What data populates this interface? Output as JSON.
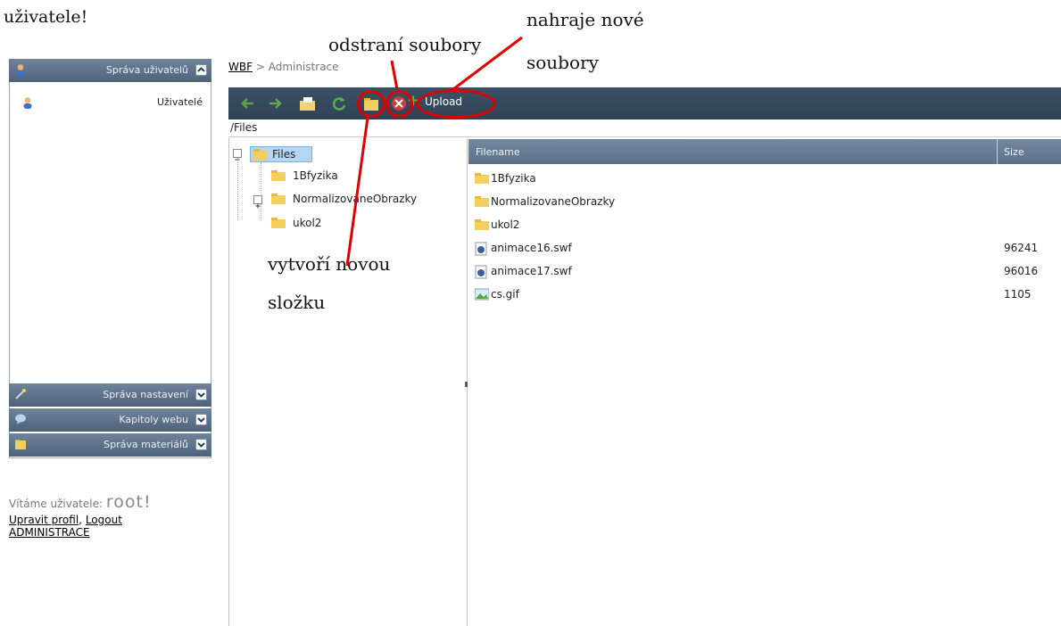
{
  "top_fragment": "uživatele!",
  "annotations": {
    "delete_files": "odstraní soubory",
    "upload_new_line1": "nahraje nové",
    "upload_new_line2": "soubory",
    "new_folder_line1": "vytvoří novou",
    "new_folder_line2": "složku"
  },
  "sidebar": {
    "sections": [
      {
        "label": "Správa uživatelů",
        "icon": "user-icon",
        "expanded": true
      },
      {
        "label": "Správa nastavení",
        "icon": "wand-icon",
        "expanded": false
      },
      {
        "label": "Kapitoly webu",
        "icon": "speech-bubble-icon",
        "expanded": false
      },
      {
        "label": "Správa materiálů",
        "icon": "folder-icon",
        "expanded": false
      }
    ],
    "items": [
      {
        "label": "Uživatelé",
        "icon": "user-icon"
      }
    ],
    "welcome_text": "Vítáme uživatele:",
    "username": "root!",
    "edit_profile": "Upravit profil",
    "logout": "Logout",
    "admin_link": "ADMINISTRACE"
  },
  "breadcrumb": {
    "link": "WBF",
    "separator": ">",
    "current": "Administrace"
  },
  "toolbar": {
    "upload_label": "Upload"
  },
  "path": "/Files",
  "tree": {
    "root": "Files",
    "children": [
      "1Bfyzika",
      "NormalizovaneObrazky",
      "ukol2"
    ]
  },
  "grid": {
    "columns": {
      "name": "Filename",
      "size": "Size"
    },
    "rows": [
      {
        "name": "1Bfyzika",
        "size": "",
        "type": "folder"
      },
      {
        "name": "NormalizovaneObrazky",
        "size": "",
        "type": "folder"
      },
      {
        "name": "ukol2",
        "size": "",
        "type": "folder"
      },
      {
        "name": "animace16.swf",
        "size": "96241",
        "type": "flash"
      },
      {
        "name": "animace17.swf",
        "size": "96016",
        "type": "flash"
      },
      {
        "name": "cs.gif",
        "size": "1105",
        "type": "image"
      }
    ]
  },
  "colors": {
    "accent_red": "#e00000",
    "toolbar": "#2f4256",
    "header": "#5b7189"
  }
}
